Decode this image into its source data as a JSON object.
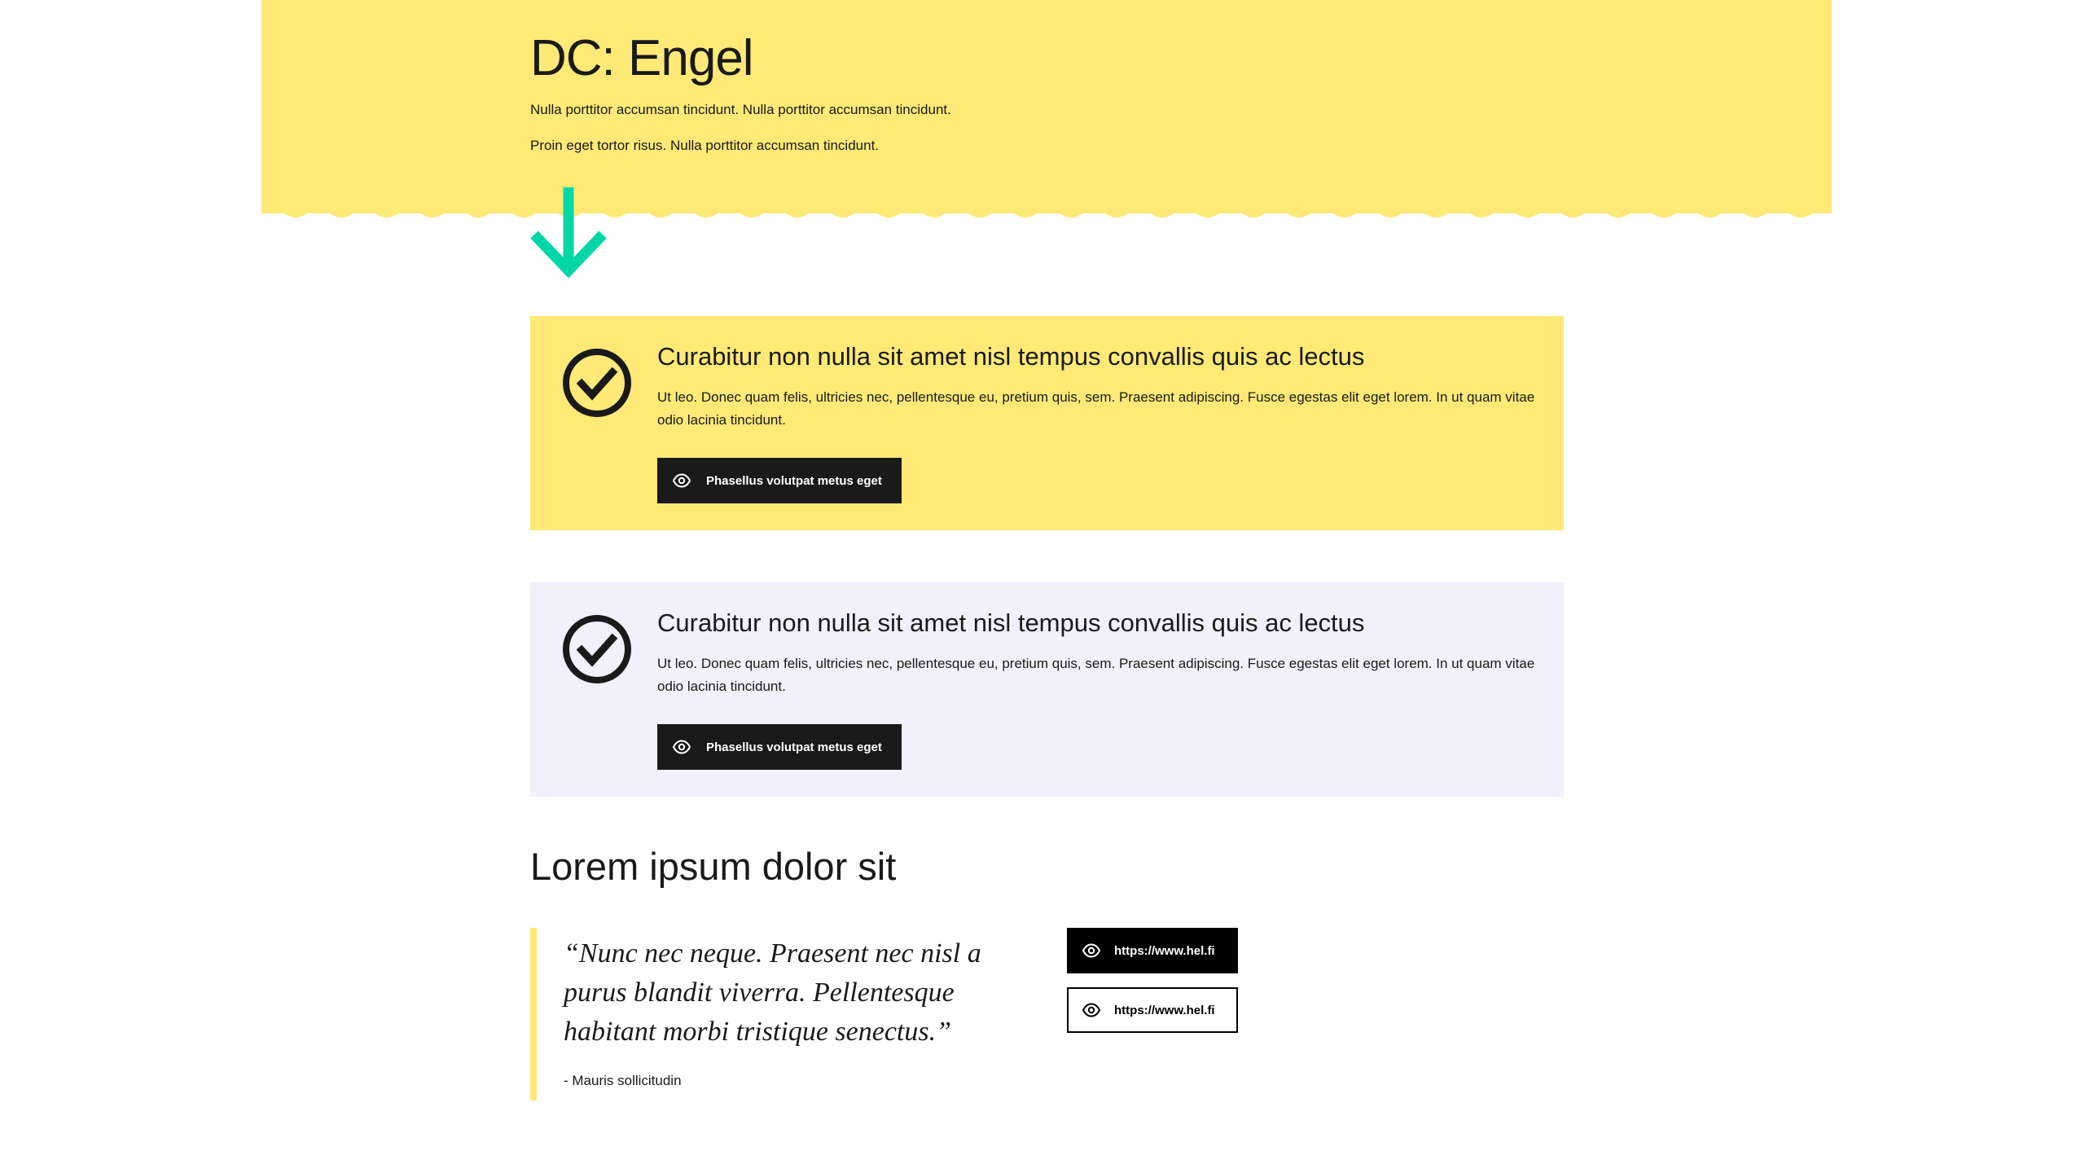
{
  "hero": {
    "title": "DC: Engel",
    "paragraphs": [
      "Nulla porttitor accumsan tincidunt. Nulla porttitor accumsan tincidunt.",
      "Proin eget tortor risus. Nulla porttitor accumsan tincidunt."
    ],
    "background_color": "#ffe977",
    "arrow_icon": "arrow-down-icon",
    "arrow_color": "#00d7a7"
  },
  "cards": [
    {
      "title": "Curabitur non nulla sit amet nisl tempus convallis quis ac lectus",
      "text": "Ut leo. Donec quam felis, ultricies nec, pellentesque eu, pretium quis, sem. Praesent adipiscing. Fusce egestas elit eget lorem. In ut quam vitae odio lacinia tincidunt.",
      "button_label": "Phasellus volutpat metus eget",
      "icon": "check-circle-icon",
      "background_color": "#ffe977"
    },
    {
      "title": "Curabitur non nulla sit amet nisl tempus convallis quis ac lectus",
      "text": "Ut leo. Donec quam felis, ultricies nec, pellentesque eu, pretium quis, sem. Praesent adipiscing. Fusce egestas elit eget lorem. In ut quam vitae odio lacinia tincidunt.",
      "button_label": "Phasellus volutpat metus eget",
      "icon": "check-circle-icon",
      "background_color": "#f1f0fb"
    }
  ],
  "section": {
    "title": "Lorem ipsum dolor sit"
  },
  "quote": {
    "text": "“Nunc nec neque. Praesent nec nisl a purus blandit viverra. Pellentesque habitant morbi tristique senectus.”",
    "author": "- Mauris sollicitudin",
    "border_color": "#ffe977"
  },
  "links": [
    {
      "label": "https://www.hel.fi",
      "icon": "eye-icon",
      "style": "filled"
    },
    {
      "label": "https://www.hel.fi",
      "icon": "eye-icon",
      "style": "outlined"
    }
  ]
}
